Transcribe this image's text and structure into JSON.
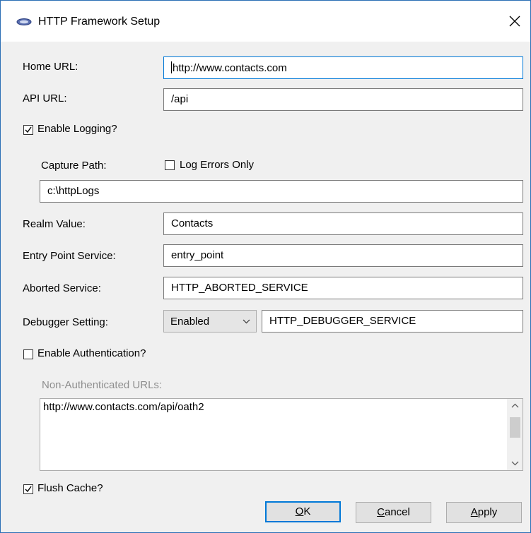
{
  "window": {
    "title": "HTTP Framework Setup",
    "icon": "app-icon",
    "close_icon": "close-icon"
  },
  "form": {
    "home_url": {
      "label": "Home URL:",
      "value": "http://www.contacts.com"
    },
    "api_url": {
      "label": "API URL:",
      "value": "/api"
    },
    "enable_logging": {
      "label": "Enable Logging?",
      "checked": true
    },
    "capture_path": {
      "label": "Capture Path:",
      "value": "c:\\httpLogs"
    },
    "log_errors_only": {
      "label": "Log Errors Only",
      "checked": false
    },
    "realm_value": {
      "label": "Realm Value:",
      "value": "Contacts"
    },
    "entry_point_service": {
      "label": "Entry Point Service:",
      "value": "entry_point"
    },
    "aborted_service": {
      "label": "Aborted Service:",
      "value": "HTTP_ABORTED_SERVICE"
    },
    "debugger_setting": {
      "label": "Debugger Setting:",
      "selected": "Enabled",
      "service_value": "HTTP_DEBUGGER_SERVICE"
    },
    "enable_authentication": {
      "label": "Enable Authentication?",
      "checked": false
    },
    "non_authenticated_urls": {
      "label": "Non-Authenticated URLs:",
      "items": [
        "http://www.contacts.com/api/oath2"
      ]
    },
    "flush_cache": {
      "label": "Flush Cache?",
      "checked": true
    }
  },
  "buttons": {
    "ok": {
      "mnemonic": "O",
      "rest": "K"
    },
    "cancel": {
      "mnemonic": "C",
      "rest": "ancel"
    },
    "apply": {
      "mnemonic": "A",
      "rest": "pply"
    }
  },
  "colors": {
    "focus_border": "#0078d7",
    "window_border": "#2b6fb5",
    "dialog_background": "#f0f0f0",
    "disabled_text": "#8e8e8e"
  }
}
